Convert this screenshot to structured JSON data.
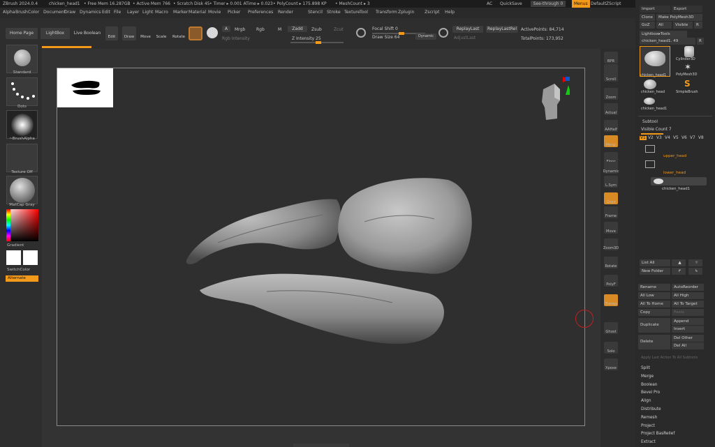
{
  "app": {
    "title": "ZBrush 2024.0.4",
    "doc": "chicken_head1",
    "free_mem": "• Free Mem 16.287GB",
    "active_mem": "• Active Mem 766",
    "scratch": "• Scratch Disk 45",
    "timer": "• Timer ▸ 0.001 ATime ▸ 0.023",
    "polycount": "• PolyCount ▸ 175.898 KP",
    "meshcount": "• MeshCount ▸ 3",
    "ac": "AC",
    "quicksave": "QuickSave",
    "seethrough": "See-through",
    "seethrough_val": "0",
    "menus": "Menus",
    "script": "DefaultZScript"
  },
  "menu": [
    "Alpha",
    "Brush",
    "Color",
    "Document",
    "Draw",
    "Dynamics",
    "Edit",
    "File",
    "Layer",
    "Light",
    "Macro",
    "Marker",
    "Material",
    "Movie",
    "Picker",
    "Preferences",
    "Render",
    "Stencil",
    "Stroke",
    "Texture",
    "Tool",
    "Transform",
    "Zplugin",
    "Zscript",
    "Help"
  ],
  "toolbar": {
    "home": "Home Page",
    "lightbox": "LightBox",
    "liveboolean": "Live Boolean",
    "edit": "Edit",
    "draw": "Draw",
    "move": "Move",
    "scale": "Scale",
    "rotate": "Rotate",
    "a": "A",
    "mrgb": "Mrgb",
    "rgb": "Rgb",
    "m": "M",
    "zadd": "Zadd",
    "zsub": "Zsub",
    "zcut": "Zcut",
    "rgb_int": "Rgb Intensity",
    "z_int": "Z Intensity 25",
    "focal": "Focal Shift 0",
    "drawsize": "Draw Size 64",
    "dynamic": "Dynamic",
    "replaylast": "ReplayLast",
    "replaylastrel": "ReplayLastRel",
    "adjustlast": "AdjustLast",
    "activepoints": "ActivePoints: 84,714",
    "totalpoints": "TotalPoints: 173,952"
  },
  "left": {
    "standard": "Standard",
    "dots": "Dots",
    "brushalpha": "~BrushAlpha",
    "textureoff": "Texture Off",
    "matcap": "MatCap Gray",
    "gradient": "Gradient",
    "switchcolor": "SwitchColor",
    "alternate": "Alternate"
  },
  "right": [
    "BPR",
    "SPix 3",
    "Scroll",
    "Zoom",
    "Actual",
    "AAHalf",
    "Persp",
    "Floor",
    "Dynamic",
    "L.Sym",
    "Qxyz",
    "Frame",
    "Move",
    "Zoom3D",
    "Rotate",
    "PolyF",
    "Transp",
    "Ghost",
    "Solo",
    "Xpose"
  ],
  "panel": {
    "import": "Import",
    "export": "Export",
    "clone": "Clone",
    "makepm": "Make PolyMesh3D",
    "goz": "GoZ",
    "all": "All",
    "visible": "Visible",
    "r": "R",
    "lightboxtools": "Lightbox▸Tools",
    "toolname": "chicken_head1. 49",
    "tools": [
      "chicken_head1",
      "Cylinder3D",
      "PolyMesh3D",
      "chicken_head",
      "SimpleBrush",
      "chicken_head1"
    ],
    "subtool": "Subtool",
    "visiblecount": "Visible Count 7",
    "vs": [
      "V1",
      "V2",
      "V3",
      "V4",
      "V5",
      "V6",
      "V7",
      "V8"
    ],
    "sub_items": [
      "upper_head",
      "lower_head",
      "chicken_head1"
    ],
    "listall": "List All",
    "newfolder": "New Folder",
    "rename": "Rename",
    "autoreorder": "AutoReorder",
    "alllow": "All Low",
    "allhigh": "All High",
    "alltohome": "All To Home",
    "alltotarget": "All To Target",
    "copy": "Copy",
    "paste": "Paste",
    "duplicate": "Duplicate",
    "append": "Append",
    "insert": "Insert",
    "delete": "Delete",
    "delother": "Del Other",
    "delall": "Del All",
    "applylast": "Apply Last Action To All Subtools",
    "list": [
      "Split",
      "Merge",
      "Boolean",
      "Bevel Pro",
      "Align",
      "Distribute",
      "Remesh",
      "Project",
      "Project BasRelief",
      "Extract"
    ]
  }
}
